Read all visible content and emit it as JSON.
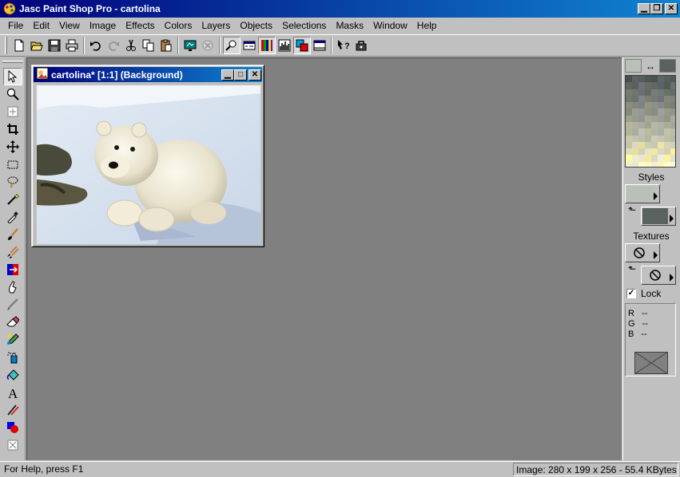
{
  "window": {
    "title": "Jasc Paint Shop Pro - cartolina"
  },
  "menubar": {
    "items": [
      {
        "label": "File"
      },
      {
        "label": "Edit"
      },
      {
        "label": "View"
      },
      {
        "label": "Image"
      },
      {
        "label": "Effects"
      },
      {
        "label": "Colors"
      },
      {
        "label": "Layers"
      },
      {
        "label": "Objects"
      },
      {
        "label": "Selections"
      },
      {
        "label": "Masks"
      },
      {
        "label": "Window"
      },
      {
        "label": "Help"
      }
    ]
  },
  "toolbar": {
    "buttons": [
      "new-file-icon",
      "open-file-icon",
      "save-icon",
      "print-icon",
      "undo-icon",
      "redo-icon",
      "cut-icon",
      "copy-icon",
      "paste-icon",
      "full-screen-preview-icon",
      "cancel-icon",
      "overview-window-icon",
      "tool-options-icon",
      "color-palette-icon",
      "histogram-icon",
      "layer-palette-icon",
      "toggle-toolbars-icon",
      "context-help-icon",
      "script-icon"
    ]
  },
  "tools": [
    "arrow-icon",
    "zoom-icon",
    "deformation-icon",
    "crop-icon",
    "mover-icon",
    "selection-icon",
    "freehand-selection-icon",
    "magic-wand-icon",
    "dropper-icon",
    "paintbrush-icon",
    "clone-brush-icon",
    "color-replacer-icon",
    "retouch-icon",
    "scratch-remover-icon",
    "eraser-icon",
    "picture-tube-icon",
    "airbrush-icon",
    "flood-fill-icon",
    "text-icon",
    "draw-icon",
    "preset-shapes-icon",
    "object-selector-icon"
  ],
  "image_window": {
    "title": "cartolina* [1:1] (Background)"
  },
  "colors": {
    "foreground": "#b8c0b8",
    "background": "#5a6260",
    "title_active_start": "#00007b",
    "title_active_end": "#1084d0",
    "workspace": "#808080"
  },
  "right_panel": {
    "styles_label": "Styles",
    "textures_label": "Textures",
    "lock_label": "Lock",
    "lock_checked": true,
    "rgb": [
      {
        "channel": "R",
        "value": "--"
      },
      {
        "channel": "G",
        "value": "--"
      },
      {
        "channel": "B",
        "value": "--"
      }
    ]
  },
  "statusbar": {
    "help_text": "For Help, press F1",
    "image_info": "Image:  280 x 199 x 256 - 55.4 KBytes"
  }
}
